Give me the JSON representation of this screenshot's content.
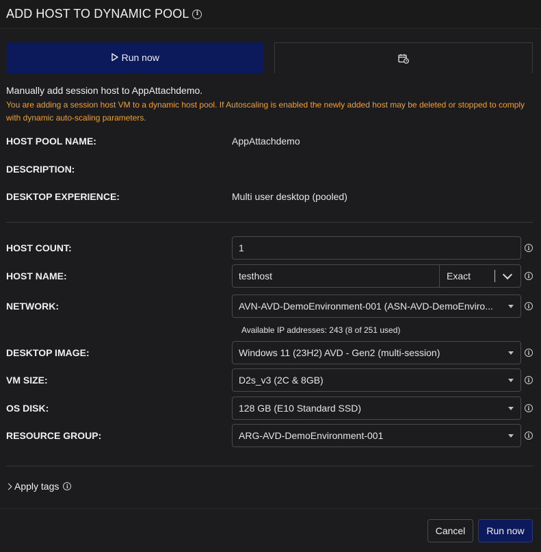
{
  "header": {
    "title": "ADD HOST TO DYNAMIC POOL"
  },
  "tabs": [
    {
      "label": "Run now",
      "icon": "play-icon",
      "active": true
    },
    {
      "label": "",
      "icon": "calendar-schedule-icon",
      "active": false
    }
  ],
  "intro": {
    "main": "Manually add session host to AppAttachdemo.",
    "warning": "You are adding a session host VM to a dynamic host pool. If Autoscaling is enabled the newly added host may be deleted or stopped to comply with dynamic auto-scaling parameters."
  },
  "info": {
    "host_pool_name": {
      "label": "HOST POOL NAME:",
      "value": "AppAttachdemo"
    },
    "description": {
      "label": "DESCRIPTION:",
      "value": ""
    },
    "desktop_experience": {
      "label": "DESKTOP EXPERIENCE:",
      "value": "Multi user desktop (pooled)"
    }
  },
  "form": {
    "host_count": {
      "label": "HOST COUNT:",
      "value": "1"
    },
    "host_name": {
      "label": "HOST NAME:",
      "value": "testhost",
      "mode": "Exact"
    },
    "network": {
      "label": "NETWORK:",
      "value": "AVN-AVD-DemoEnvironment-001 (ASN-AVD-DemoEnviro...",
      "ip_info": "Available IP addresses: 243 (8 of 251 used)"
    },
    "desktop_image": {
      "label": "DESKTOP IMAGE:",
      "value": "Windows 11 (23H2) AVD - Gen2 (multi-session)"
    },
    "vm_size": {
      "label": "VM SIZE:",
      "value": "D2s_v3 (2C & 8GB)"
    },
    "os_disk": {
      "label": "OS DISK:",
      "value": "128 GB (E10 Standard SSD)"
    },
    "resource_group": {
      "label": "RESOURCE GROUP:",
      "value": "ARG-AVD-DemoEnvironment-001"
    }
  },
  "apply_tags": {
    "label": "Apply tags"
  },
  "footer": {
    "cancel_label": "Cancel",
    "run_label": "Run now"
  },
  "colors": {
    "accent": "#0c1a5c",
    "warning": "#f0a030",
    "background": "#1c1c1e"
  }
}
